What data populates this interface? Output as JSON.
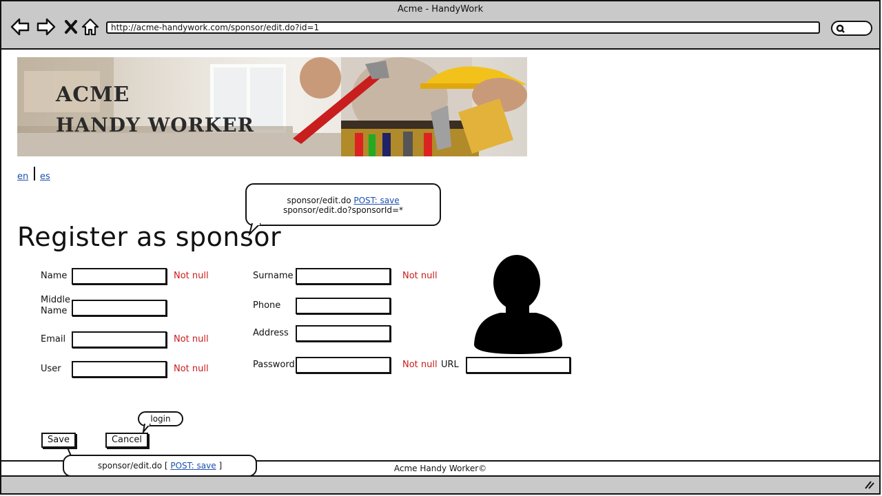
{
  "window": {
    "title": "Acme - HandyWork"
  },
  "browser": {
    "url": "http://acme-handywork.com/sponsor/edit.do?id=1"
  },
  "banner": {
    "title_line1": "ACME",
    "title_line2": "HANDY WORKER"
  },
  "lang": {
    "en": "en",
    "es": "es"
  },
  "note_top": {
    "line1_prefix": "sponsor/edit.do ",
    "line1_link": "POST: save",
    "line2": "sponsor/edit.do?sponsorId=*"
  },
  "page": {
    "title": "Register as sponsor"
  },
  "form": {
    "name_label": "Name",
    "middle_label_1": "Middle",
    "middle_label_2": "Name",
    "email_label": "Email",
    "user_label": "User",
    "surname_label": "Surname",
    "phone_label": "Phone",
    "address_label": "Address",
    "password_label": "Password",
    "url_label": "URL",
    "required_text": "Not null"
  },
  "buttons": {
    "save": "Save",
    "cancel": "Cancel"
  },
  "note_login": {
    "text": "login"
  },
  "note_bottom": {
    "prefix": "sponsor/edit.do [ ",
    "link": "POST: save",
    "suffix": " ]"
  },
  "footer": {
    "text": "Acme Handy Worker©"
  },
  "colors": {
    "required": "#cc1a1a",
    "link": "#1a4fb0",
    "chrome": "#c9c9c9"
  },
  "icons": [
    "back-arrow-icon",
    "forward-arrow-icon",
    "close-icon",
    "home-icon",
    "search-icon",
    "avatar-icon",
    "resize-grip-icon"
  ]
}
